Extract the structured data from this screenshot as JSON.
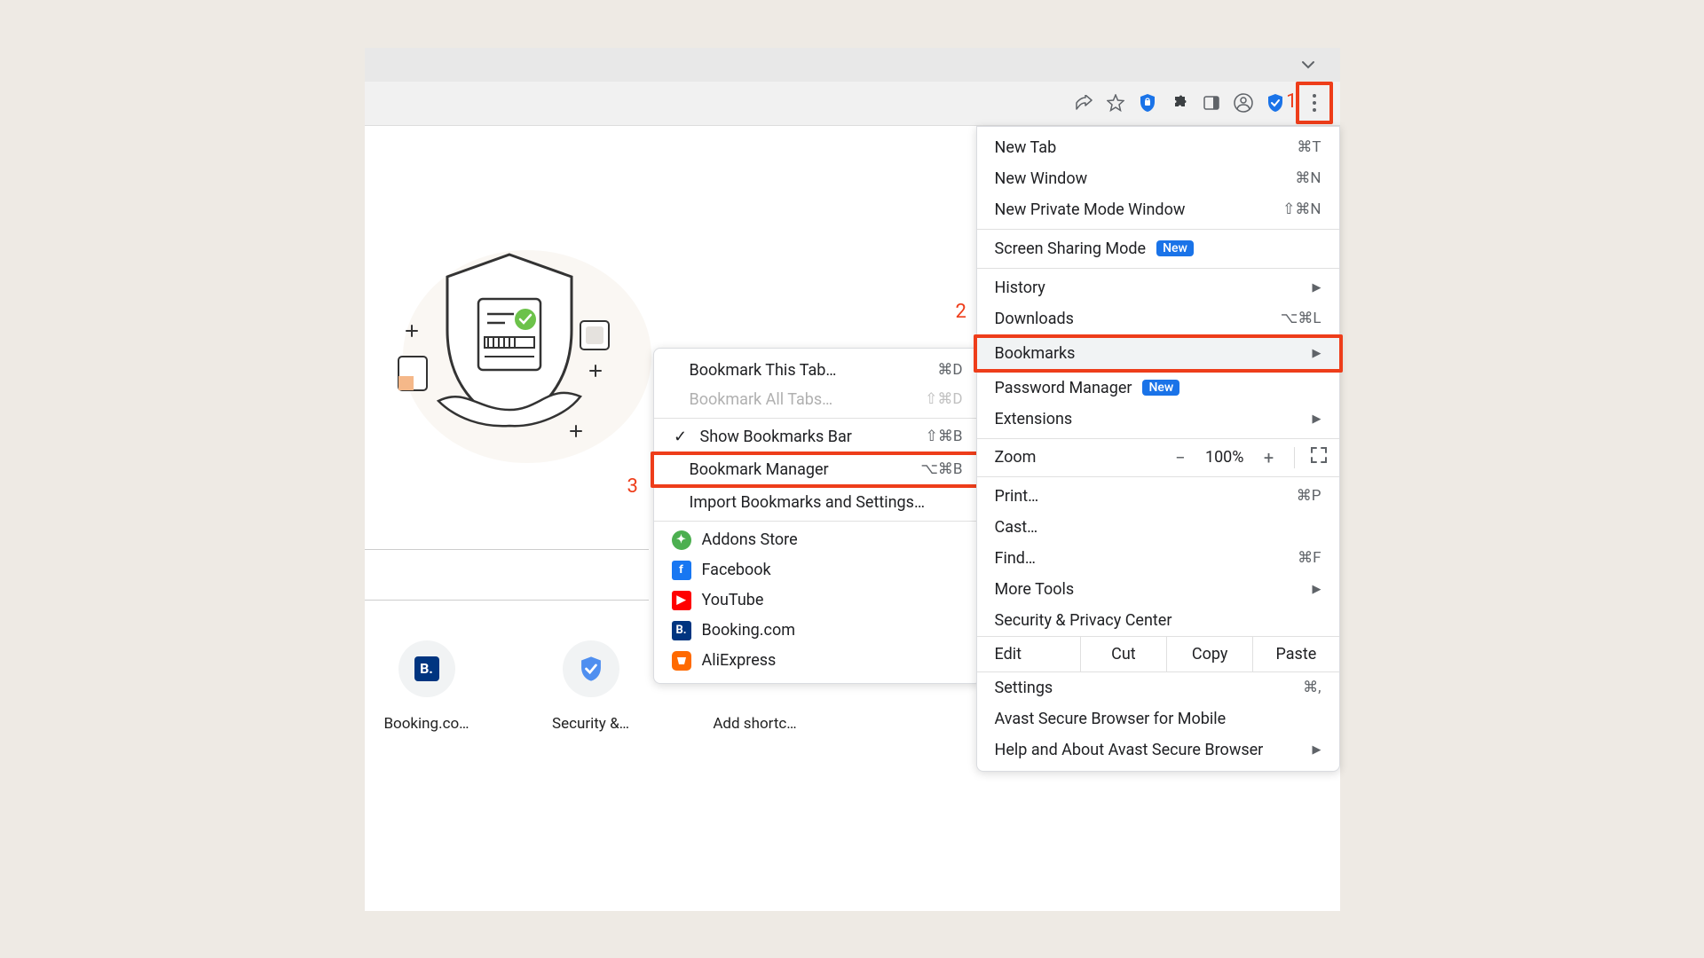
{
  "steps": {
    "one": "1",
    "two": "2",
    "three": "3"
  },
  "shortcuts": [
    {
      "label": "Booking.co…"
    },
    {
      "label": "Security &…"
    },
    {
      "label": "Add shortc…"
    }
  ],
  "main_menu": {
    "new_tab": {
      "label": "New Tab",
      "shortcut": "⌘T"
    },
    "new_window": {
      "label": "New Window",
      "shortcut": "⌘N"
    },
    "new_private": {
      "label": "New Private Mode Window",
      "shortcut": "⇧⌘N"
    },
    "screen_sharing": {
      "label": "Screen Sharing Mode",
      "badge": "New"
    },
    "history": {
      "label": "History"
    },
    "downloads": {
      "label": "Downloads",
      "shortcut": "⌥⌘L"
    },
    "bookmarks": {
      "label": "Bookmarks"
    },
    "password_manager": {
      "label": "Password Manager",
      "badge": "New"
    },
    "extensions": {
      "label": "Extensions"
    },
    "zoom": {
      "label": "Zoom",
      "minus": "−",
      "value": "100%",
      "plus": "+"
    },
    "print": {
      "label": "Print…",
      "shortcut": "⌘P"
    },
    "cast": {
      "label": "Cast…"
    },
    "find": {
      "label": "Find…",
      "shortcut": "⌘F"
    },
    "more_tools": {
      "label": "More Tools"
    },
    "security_center": {
      "label": "Security & Privacy Center"
    },
    "edit": {
      "label": "Edit",
      "cut": "Cut",
      "copy": "Copy",
      "paste": "Paste"
    },
    "settings": {
      "label": "Settings",
      "shortcut": "⌘,"
    },
    "avast_mobile": {
      "label": "Avast Secure Browser for Mobile"
    },
    "help": {
      "label": "Help and About Avast Secure Browser"
    }
  },
  "submenu": {
    "bookmark_tab": {
      "label": "Bookmark This Tab…",
      "shortcut": "⌘D"
    },
    "bookmark_all": {
      "label": "Bookmark All Tabs…",
      "shortcut": "⇧⌘D"
    },
    "show_bar": {
      "label": "Show Bookmarks Bar",
      "shortcut": "⇧⌘B"
    },
    "manager": {
      "label": "Bookmark Manager",
      "shortcut": "⌥⌘B"
    },
    "import": {
      "label": "Import Bookmarks and Settings…"
    },
    "addons": {
      "label": "Addons Store"
    },
    "facebook": {
      "label": "Facebook"
    },
    "youtube": {
      "label": "YouTube"
    },
    "booking": {
      "label": "Booking.com"
    },
    "aliexpress": {
      "label": "AliExpress"
    }
  }
}
